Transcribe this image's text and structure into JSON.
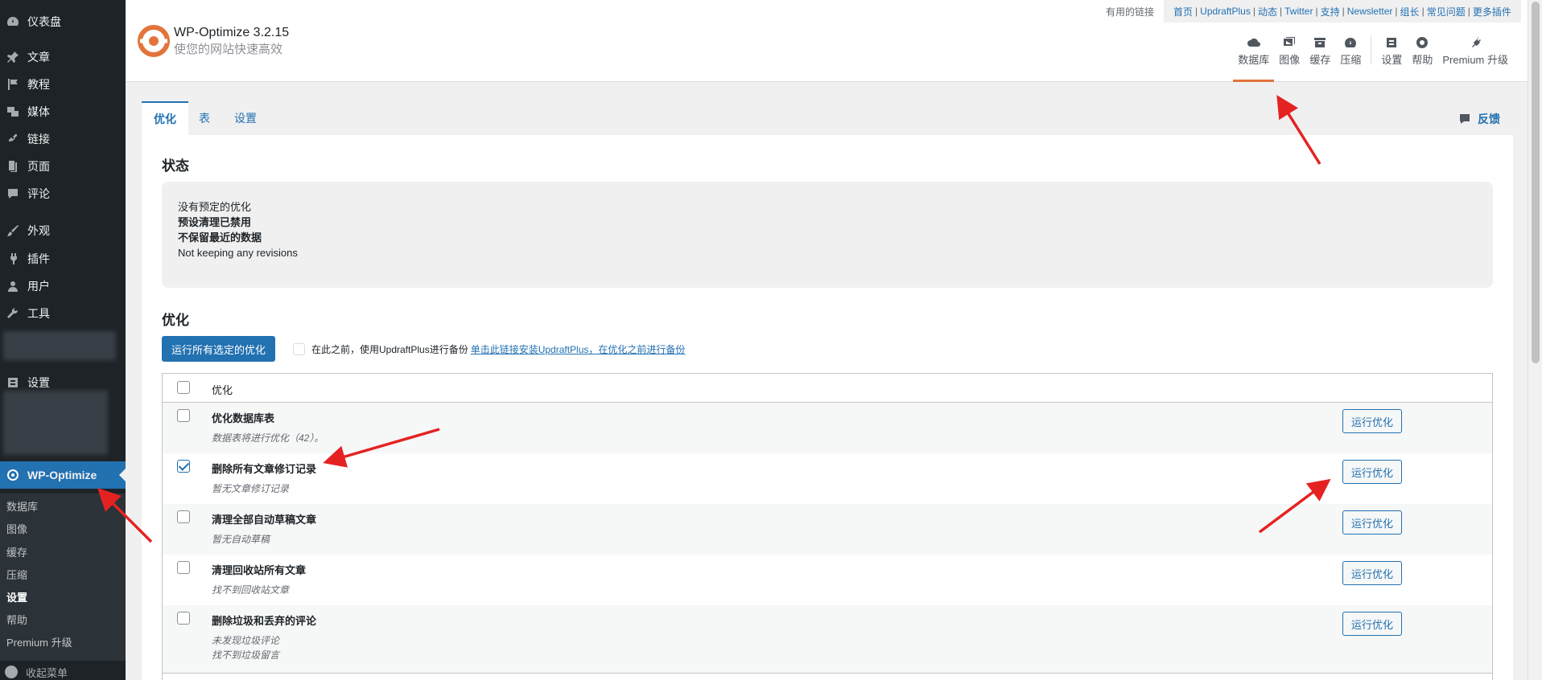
{
  "sidebar": {
    "items": [
      {
        "label": "仪表盘",
        "icon": "dashboard-icon"
      },
      {
        "label": "文章",
        "icon": "pin-icon"
      },
      {
        "label": "教程",
        "icon": "flag-icon"
      },
      {
        "label": "媒体",
        "icon": "media-icon"
      },
      {
        "label": "链接",
        "icon": "link-icon"
      },
      {
        "label": "页面",
        "icon": "page-icon"
      },
      {
        "label": "评论",
        "icon": "comment-icon"
      },
      {
        "label": "外观",
        "icon": "brush-icon"
      },
      {
        "label": "插件",
        "icon": "plugin-icon"
      },
      {
        "label": "用户",
        "icon": "user-icon"
      },
      {
        "label": "工具",
        "icon": "wrench-icon"
      },
      {
        "label": "设置",
        "icon": "settings-icon"
      },
      {
        "label": "WP-Optimize",
        "icon": "wp-optimize-icon"
      }
    ],
    "submenu": [
      "数据库",
      "图像",
      "缓存",
      "压缩",
      "设置",
      "帮助",
      "Premium 升级"
    ],
    "collapse_label": "收起菜单"
  },
  "header": {
    "title": "WP-Optimize 3.2.15",
    "subtitle": "使您的网站快速高效",
    "useful_links_label": "有用的链接",
    "links": [
      "首页",
      "UpdraftPlus",
      "动态",
      "Twitter",
      "支持",
      "Newsletter",
      "组长",
      "常见问题",
      "更多插件"
    ],
    "tabs": [
      {
        "label": "数据库",
        "icon": "cloud-icon"
      },
      {
        "label": "图像",
        "icon": "images-icon"
      },
      {
        "label": "缓存",
        "icon": "archive-icon"
      },
      {
        "label": "压缩",
        "icon": "dashboard-gauge-icon"
      },
      {
        "label": "设置",
        "icon": "admin-settings-icon"
      },
      {
        "label": "帮助",
        "icon": "help-lifebuoy-icon"
      },
      {
        "label": "Premium 升级",
        "icon": "plug-icon"
      }
    ]
  },
  "subtabs": [
    "优化",
    "表",
    "设置"
  ],
  "feedback_label": "反馈",
  "status": {
    "title": "状态",
    "lines": [
      "没有预定的优化",
      "预设清理已禁用",
      "不保留最近的数据",
      "Not keeping any revisions"
    ]
  },
  "optimize": {
    "title": "优化",
    "run_all_label": "运行所有选定的优化",
    "backup_text": "在此之前，使用UpdraftPlus进行备份",
    "backup_link": "单击此链接安装UpdraftPlus，在优化之前进行备份",
    "column_header": "优化",
    "run_button_label": "运行优化",
    "rows": [
      {
        "title": "优化数据库表",
        "desc": [
          "数据表将进行优化（42）。"
        ],
        "checked": false
      },
      {
        "title": "删除所有文章修订记录",
        "desc": [
          "暂无文章修订记录"
        ],
        "checked": true
      },
      {
        "title": "清理全部自动草稿文章",
        "desc": [
          "暂无自动草稿"
        ],
        "checked": false
      },
      {
        "title": "清理回收站所有文章",
        "desc": [
          "找不到回收站文章"
        ],
        "checked": false
      },
      {
        "title": "删除垃圾和丢弃的评论",
        "desc": [
          "未发现垃圾评论",
          "找不到垃圾留言"
        ],
        "checked": false
      }
    ]
  },
  "colors": {
    "accent": "#2271b1",
    "sidebar_bg": "#1d2327",
    "arrow": "#e52222",
    "active_tab_underline": "#e2743b"
  }
}
